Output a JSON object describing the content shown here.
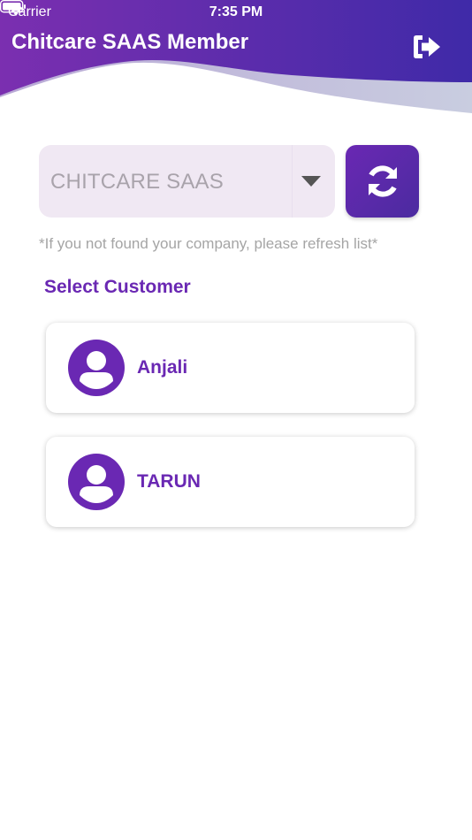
{
  "status_bar": {
    "carrier": "Carrier",
    "time": "7:35 PM"
  },
  "header": {
    "title": "Chitcare SAAS Member",
    "logout_icon": "logout-icon"
  },
  "company_select": {
    "selected": "CHITCARE SAAS",
    "caret_icon": "caret-down-icon"
  },
  "refresh_button": {
    "icon": "refresh-icon"
  },
  "hint": "*If you not found your company, please refresh list*",
  "section_title": "Select Customer",
  "customers": [
    {
      "name": "Anjali"
    },
    {
      "name": "TARUN"
    }
  ],
  "colors": {
    "primary": "#6a28b3",
    "header_gradient_start": "#7b2fb0",
    "header_gradient_end": "#3f2aa8",
    "select_bg": "#f0e8f3",
    "hint": "#a5a5a5"
  }
}
